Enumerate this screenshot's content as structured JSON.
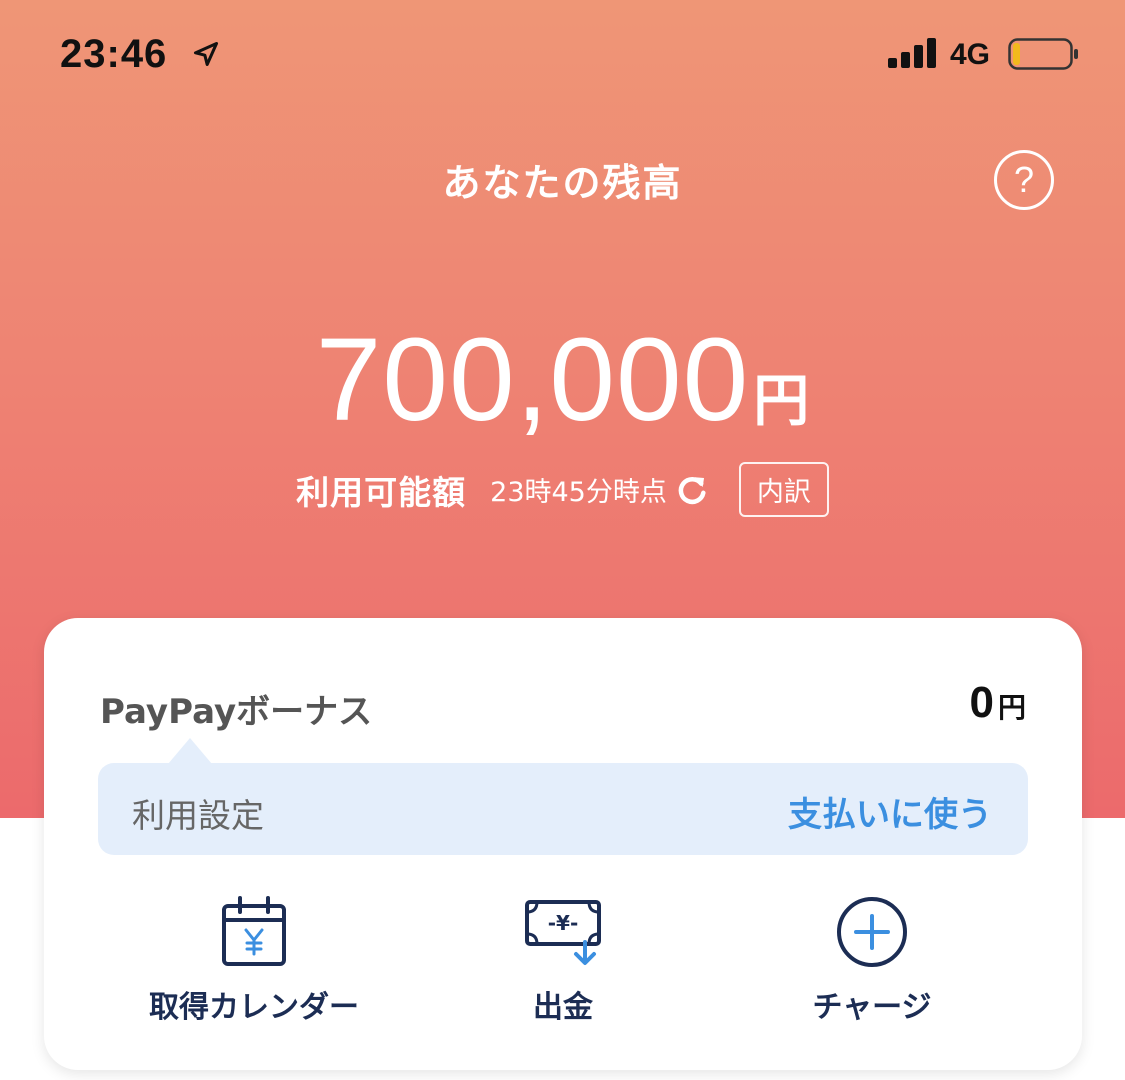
{
  "status_bar": {
    "time": "23:46",
    "network": "4G"
  },
  "header": {
    "title": "あなたの残高",
    "help_label": "?"
  },
  "balance": {
    "amount": "700,000",
    "unit": "円",
    "available_label": "利用可能額",
    "as_of": "23時45分時点",
    "breakdown_label": "内訳"
  },
  "bonus_card": {
    "label": "PayPayボーナス",
    "amount": "0",
    "unit": "円",
    "setting_label": "利用設定",
    "setting_value": "支払いに使う",
    "actions": [
      {
        "label": "取得カレンダー",
        "icon": "calendar-yen-icon"
      },
      {
        "label": "出金",
        "icon": "withdraw-icon"
      },
      {
        "label": "チャージ",
        "icon": "plus-circle-icon"
      }
    ]
  },
  "colors": {
    "hero_top": "#ef9676",
    "hero_bottom": "#ec6a6c",
    "accent_blue": "#3b8fe0",
    "icon_navy": "#1c2d54"
  }
}
